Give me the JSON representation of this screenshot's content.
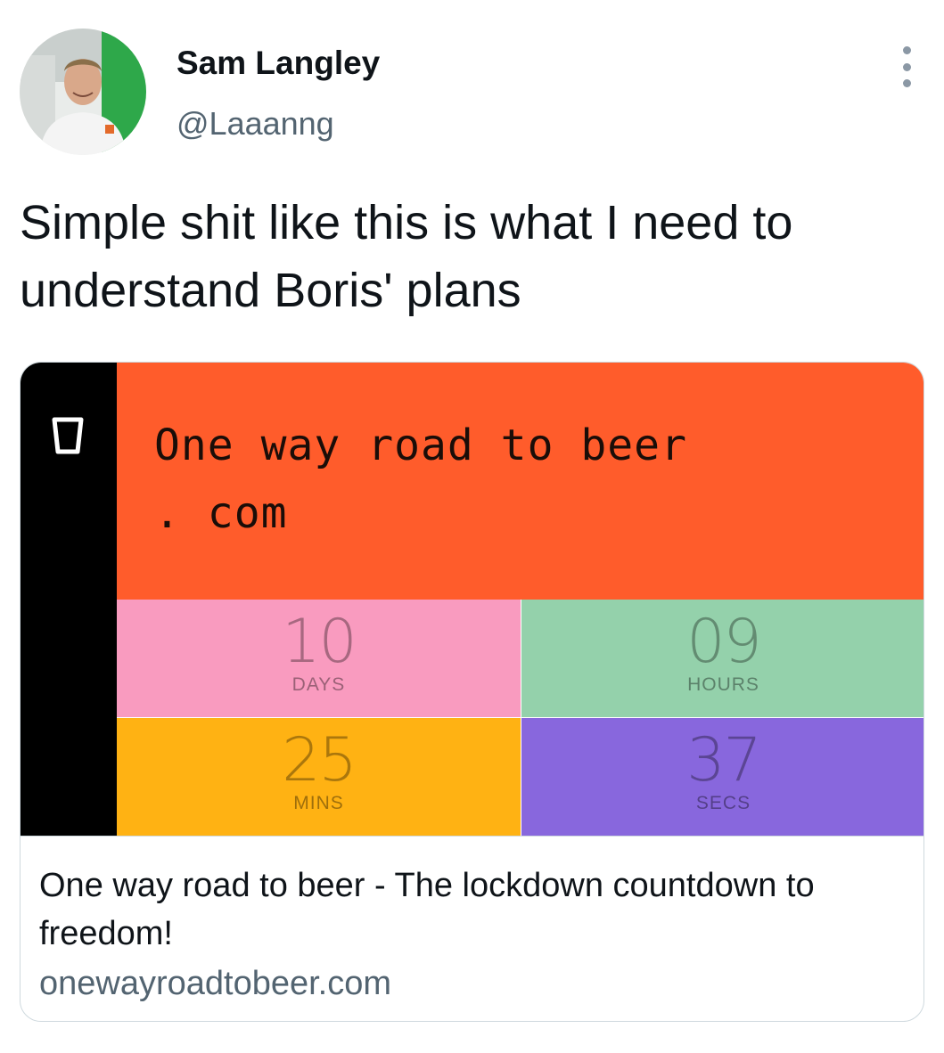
{
  "author": {
    "display_name": "Sam Langley",
    "handle": "@Laaanng"
  },
  "tweet": {
    "text": "Simple shit like this is what I need to understand Boris' plans"
  },
  "card": {
    "hero_title_line1": "One way road to beer",
    "hero_title_line2": ". com",
    "icon": "beer-glass-icon",
    "countdown": [
      {
        "value": "10",
        "unit": "DAYS",
        "color": "#f99bbf"
      },
      {
        "value": "09",
        "unit": "HOURS",
        "color": "#94d1ab"
      },
      {
        "value": "25",
        "unit": "MINS",
        "color": "#ffb213"
      },
      {
        "value": "37",
        "unit": "SECS",
        "color": "#8867dd"
      }
    ],
    "accent_color": "#ff5c2b",
    "title": "One way road to beer - The lockdown countdown to freedom!",
    "domain": "onewayroadtobeer.com"
  },
  "menu": {
    "icon": "more-vertical-icon"
  }
}
